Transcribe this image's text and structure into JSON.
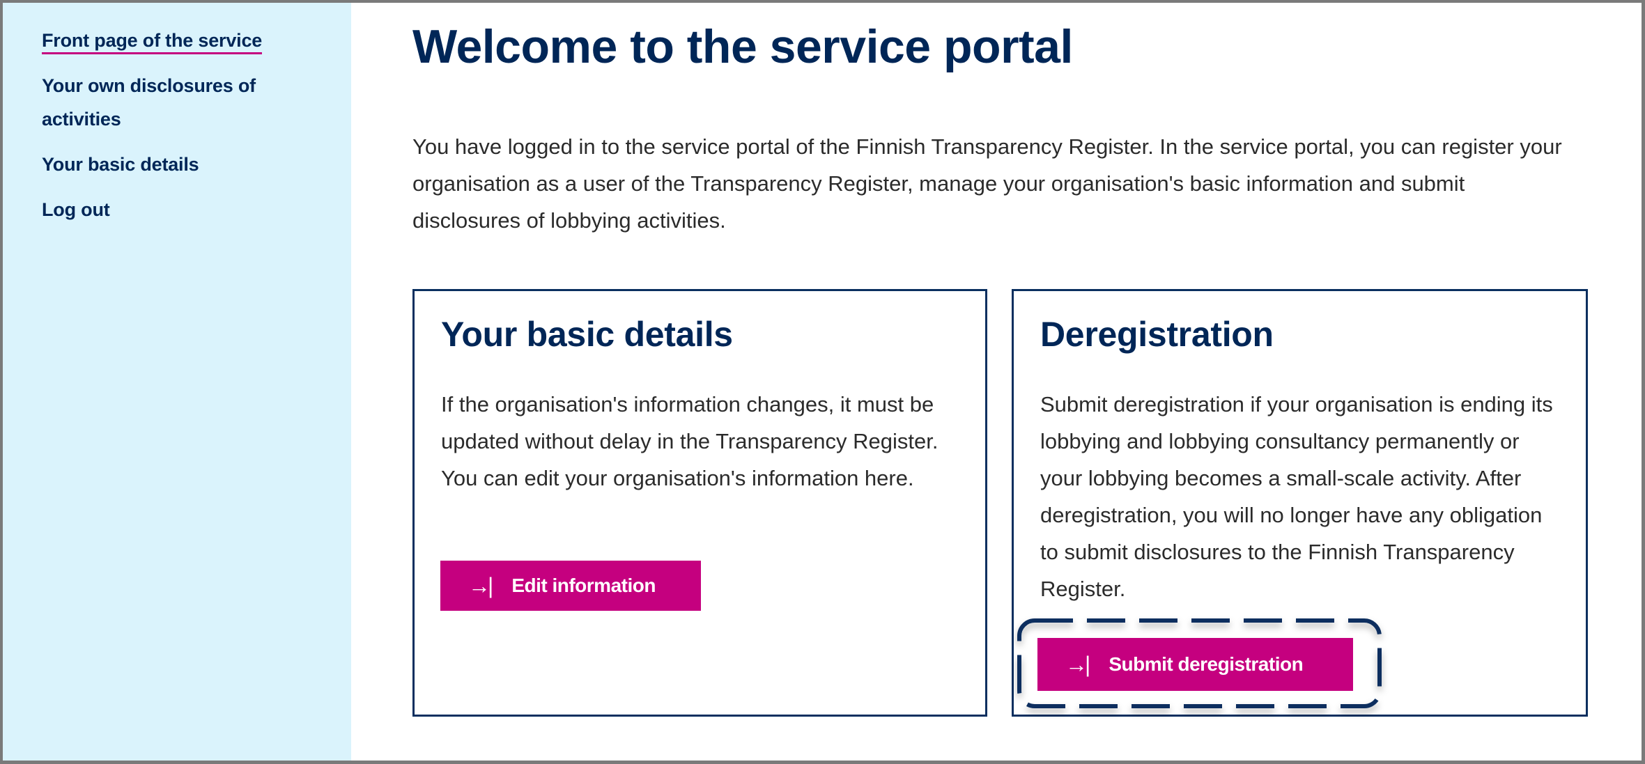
{
  "sidebar": {
    "items": [
      {
        "label": "Front page of the service",
        "active": true
      },
      {
        "label": "Your own disclosures of activities",
        "active": false
      },
      {
        "label": "Your basic details",
        "active": false
      },
      {
        "label": "Log out",
        "active": false
      }
    ]
  },
  "main": {
    "title": "Welcome to the service portal",
    "intro": "You have logged in to the service portal of the Finnish Transparency Register. In the service portal, you can register your organisation as a user of the Transparency Register, manage your organisation's basic information and submit disclosures of lobbying activities.",
    "cards": [
      {
        "title": "Your basic details",
        "text": "If the organisation's information changes, it must be updated without delay in the Transparency Register. You can edit your organisation's information here.",
        "button": {
          "icon": "arrow-right-to-bar-icon",
          "glyph": "→|",
          "label": "Edit information"
        }
      },
      {
        "title": "Deregistration",
        "text": "Submit deregistration if your organisation is ending its lobbying and lobbying consultancy permanently or your lobbying becomes a small-scale activity. After deregistration, you will no longer have any obligation to submit disclosures to the Finnish Transparency Register.",
        "button": {
          "icon": "arrow-right-to-bar-icon",
          "glyph": "→|",
          "label": "Submit deregistration"
        }
      }
    ]
  },
  "colors": {
    "brand_navy": "#002657",
    "accent_magenta": "#c5007f",
    "sidebar_bg": "#daf3fc",
    "body_text": "#2b2b2b",
    "highlight_dash": "#0a2f5f"
  }
}
